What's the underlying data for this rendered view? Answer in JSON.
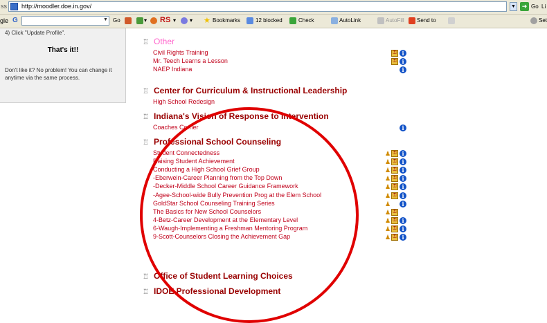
{
  "addressbar": {
    "prefix": "ss",
    "url": "http://moodler.doe.in.gov/",
    "go_label": "Go",
    "tail": "Li"
  },
  "toolbar": {
    "prefix": "gle",
    "g_logo": "G",
    "items": {
      "go": "Go",
      "rs": "RS",
      "bookmarks": "Bookmarks",
      "blocked": "12 blocked",
      "check": "Check",
      "autolink": "AutoLink",
      "autofill": "AutoFill",
      "sendto": "Send to",
      "settings": "Sett"
    }
  },
  "sidebar": {
    "step": "4) Click \"Update Profile\".",
    "title": "That's it!!",
    "note": "Don't like it? No problem! You can change it anytime via the same process."
  },
  "categories": [
    {
      "name": "Other",
      "courses": [
        {
          "name": "Civil Rights Training",
          "icons": [
            "key",
            "info"
          ]
        },
        {
          "name": "Mr. Teech Learns a Lesson",
          "icons": [
            "key",
            "info"
          ]
        },
        {
          "name": "NAEP Indiana",
          "icons": [
            "info"
          ]
        }
      ]
    },
    {
      "name": "Center for Curriculum & Instructional Leadership",
      "courses": [
        {
          "name": "High School Redesign",
          "icons": []
        }
      ]
    },
    {
      "name": "Indiana's Vision of Response to Intervention",
      "courses": [
        {
          "name": "Coaches Corner",
          "icons": [
            "info"
          ]
        }
      ]
    },
    {
      "name": "Professional School Counseling",
      "courses": [
        {
          "name": "Student Connectedness",
          "icons": [
            "guest",
            "key",
            "info"
          ]
        },
        {
          "name": "Raising Student Achievement",
          "icons": [
            "guest",
            "key",
            "info"
          ]
        },
        {
          "name": "Conducting a High School Grief Group",
          "icons": [
            "guest",
            "key",
            "info"
          ]
        },
        {
          "name": "-Eberwein-Career Planning from the Top Down",
          "icons": [
            "guest",
            "key",
            "info"
          ]
        },
        {
          "name": "-Decker-Middle School Career Guidance Framework",
          "icons": [
            "guest",
            "key",
            "info"
          ]
        },
        {
          "name": "-Agee-School-wide Bully Prevention Prog at the Elem School",
          "icons": [
            "guest",
            "key",
            "info"
          ]
        },
        {
          "name": "GoldStar School Counseling Training Series",
          "icons": [
            "guest",
            "info"
          ]
        },
        {
          "name": "The Basics for New School Counselors",
          "icons": [
            "guest",
            "key"
          ]
        },
        {
          "name": "4-Betz-Career Development at the Elementary Level",
          "icons": [
            "guest",
            "key",
            "info"
          ]
        },
        {
          "name": "6-Waugh-Implementing a Freshman Mentoring Program",
          "icons": [
            "guest",
            "key",
            "info"
          ]
        },
        {
          "name": "9-Scott-Counselors Closing the Achievement Gap",
          "icons": [
            "guest",
            "key",
            "info"
          ]
        }
      ]
    },
    {
      "name": "Office of Student Learning Choices",
      "courses": []
    },
    {
      "name": "IDOE Professional Development",
      "courses": []
    }
  ],
  "colors": {
    "category": "#990000",
    "category_other": "#ff66cc",
    "course_link": "#c0001a",
    "annotation_circle": "#e00000"
  }
}
